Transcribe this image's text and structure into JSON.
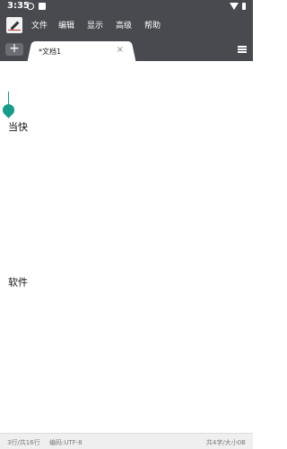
{
  "status": {
    "time": "3:35"
  },
  "menu": {
    "items": [
      "文件",
      "编辑",
      "显示",
      "高级",
      "帮助"
    ]
  },
  "tabs": {
    "add": "+",
    "active": {
      "label": "*文档1",
      "close": "×"
    }
  },
  "editor": {
    "lines": [
      "当快",
      "软件"
    ]
  },
  "footer": {
    "position": "3行/共16行",
    "encoding": "编码:UTF-8",
    "stats": "共4字/大小0B"
  },
  "colors": {
    "bar": "#494a50",
    "accent": "#159c8a"
  }
}
